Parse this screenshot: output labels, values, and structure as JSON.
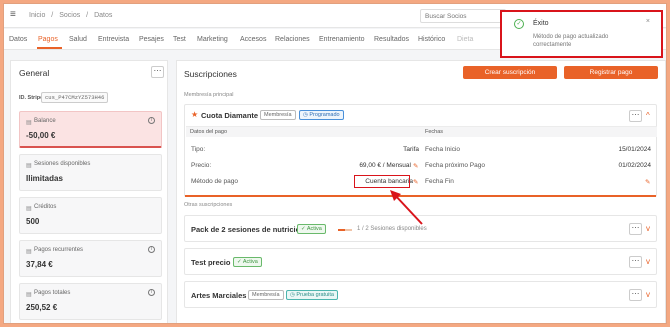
{
  "header": {
    "breadcrumb": [
      "Inicio",
      "/",
      "Socios",
      "/",
      "Datos"
    ],
    "search_placeholder": "Buscar Socios"
  },
  "tabs": [
    "Datos",
    "Pagos",
    "Salud",
    "Entrevista",
    "Pesajes",
    "Test",
    "Marketing",
    "Accesos",
    "Relaciones",
    "Entrenamiento",
    "Resultados",
    "Histórico",
    "Dieta"
  ],
  "active_tab": "Pagos",
  "general": {
    "title": "General",
    "stripe_label": "ID. Stripe",
    "stripe_id": "cus_P47CMzYZ573H46",
    "stats": [
      {
        "label": "Balance",
        "value": "-50,00 €",
        "icon": "wallet-icon",
        "info": true
      },
      {
        "label": "Sesiones disponibles",
        "value": "Ilimitadas",
        "icon": "ticket-icon",
        "info": false
      },
      {
        "label": "Créditos",
        "value": "500",
        "icon": "coin-icon",
        "info": false
      },
      {
        "label": "Pagos recurrentes",
        "value": "37,84 €",
        "icon": "calendar-icon",
        "info": true
      },
      {
        "label": "Pagos totales",
        "value": "250,52 €",
        "icon": "cash-icon",
        "info": true
      }
    ]
  },
  "subscriptions": {
    "title": "Suscripciones",
    "create_button": "Crear suscripción",
    "register_button": "Registrar pago",
    "main_label": "Membresía principal",
    "other_label": "Otras suscripciones",
    "main": {
      "name": "Cuota Diamante",
      "type_badge": "Membresía",
      "status_badge": "Programado",
      "payment_header": "Datos del pago",
      "dates_header": "Fechas",
      "rows_left": [
        {
          "label": "Tipo:",
          "value": "Tarifa"
        },
        {
          "label": "Precio:",
          "value": "69,00 € / Mensual"
        },
        {
          "label": "Método de pago",
          "value": "Cuenta bancaria"
        }
      ],
      "rows_right": [
        {
          "label": "Fecha Inicio",
          "value": "15/01/2024"
        },
        {
          "label": "Fecha próximo Pago",
          "value": "01/02/2024"
        },
        {
          "label": "Fecha Fin",
          "value": ""
        }
      ]
    },
    "others": [
      {
        "name": "Pack de 2 sesiones de nutrición",
        "badge": "Activa",
        "badge_style": "green",
        "progress_text": "1 / 2 Sesiones disponibles",
        "progress": 0.5
      },
      {
        "name": "Test precio",
        "badge": "Activa",
        "badge_style": "green"
      },
      {
        "name": "Artes Marciales",
        "type_badge": "Membresía",
        "badge": "Prueba gratuita",
        "badge_style": "teal"
      }
    ]
  },
  "toast": {
    "title": "Éxito",
    "message": "Método de pago actualizado correctamente"
  },
  "colors": {
    "accent": "#e96228",
    "highlight": "#d9141b",
    "success": "#4caf50"
  }
}
